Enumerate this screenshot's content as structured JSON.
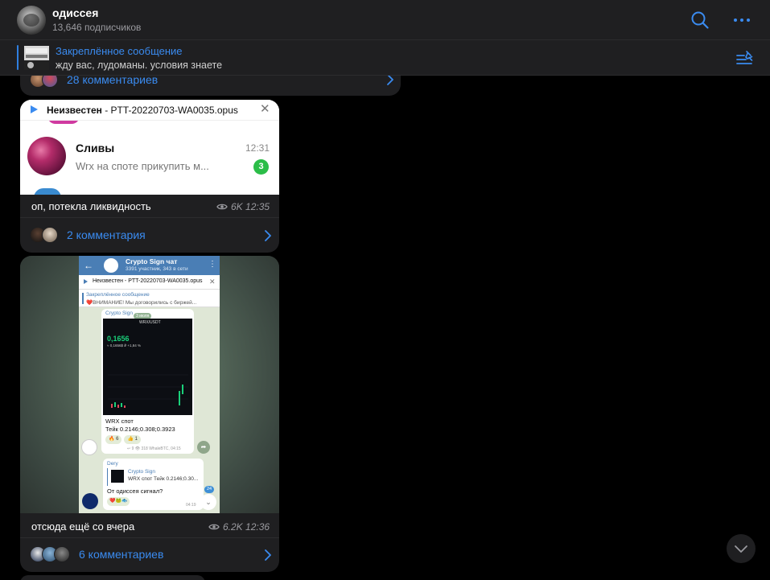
{
  "header": {
    "channel_title": "одиссея",
    "subscribers": "13,646 подписчиков"
  },
  "pinned": {
    "title": "Закреплённое сообщение",
    "text": "жду вас, лудоманы. условия знаете"
  },
  "messages": [
    {
      "comments_label": "28 комментариев"
    },
    {
      "image": {
        "audio_sender": "Неизвестен",
        "audio_file": " - PTT-20220703-WA0035.opus",
        "chat_name": "Сливы",
        "chat_time": "12:31",
        "chat_preview": "Wrx на споте прикупить м...",
        "unread_count": "3"
      },
      "caption": "оп, потекла ликвидность",
      "views": "6K",
      "time": "12:35",
      "comments_label": "2 комментария"
    },
    {
      "image": {
        "chat_title": "Crypto Sign чат",
        "chat_subtitle": "3391 участник, 343 в сети",
        "audio_text": "Неизвестен - PTT-20220703-WA0035.opus",
        "pinned_title": "Закреплённое сообщение",
        "pinned_text": "❤️ВНИМАНИЕ! Мы договорились с биржей...",
        "post_from": "Crypto Sign",
        "date_tag": "3 июля",
        "pair": "WRX/USDT",
        "price": "0,1656",
        "price_sub": "≈ 0,1656$ ₽ +1,84 %",
        "post_line1": "WRX спот",
        "post_line2": "Тейк 0.2146;0.308;0.3923",
        "reaction1": "🔥 6",
        "reaction2": "👍 1",
        "post_meta": "↩ 9  👁 318  WhaleBTC, 04:15",
        "reply_name": "Dery",
        "reply_quote_title": "Crypto Sign",
        "reply_quote_text": "WRX спот Тейк 0.2146;0.30...",
        "reply_text": "От одиссея сигнал?",
        "reply_reactions": "❤️🐸🐟",
        "reply_time": "04:19",
        "unread": "24"
      },
      "caption": "отсюда ещё со вчера",
      "views": "6.2K",
      "time": "12:36",
      "comments_label": "6 комментариев"
    }
  ],
  "colors": {
    "accent": "#3a8bf0",
    "bubble": "#1f1f21",
    "background": "#000000",
    "badge": "#2bbd48"
  },
  "icons": [
    "search-icon",
    "more-icon",
    "pinned-list-icon",
    "eye-icon",
    "chevron-right-icon",
    "chevron-down-icon",
    "play-icon",
    "close-icon"
  ]
}
